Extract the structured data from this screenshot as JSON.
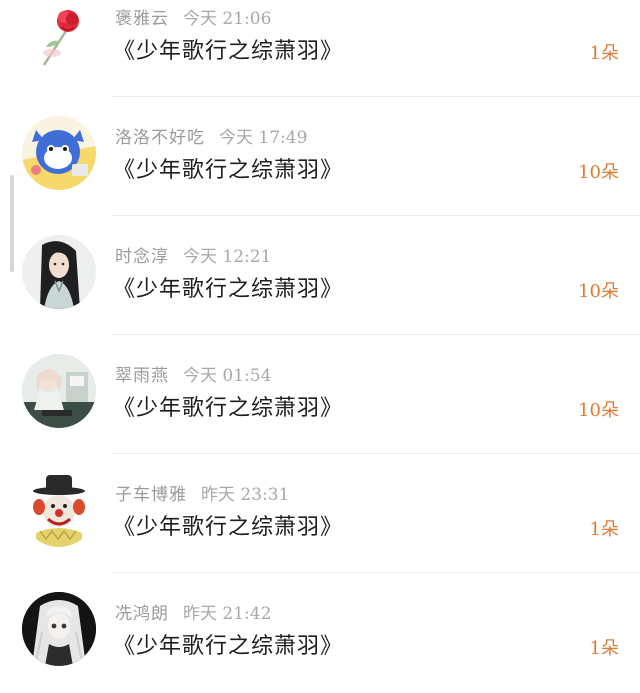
{
  "rows": [
    {
      "name": "褒雅云",
      "time": "今天 21:06",
      "gift": "《少年歌行之综萧羽》",
      "count": "1朵",
      "avatar": "rose-avatar"
    },
    {
      "name": "洛洛不好吃",
      "time": "今天 17:49",
      "gift": "《少年歌行之综萧羽》",
      "count": "10朵",
      "avatar": "cartoon-character-avatar"
    },
    {
      "name": "时念淳",
      "time": "今天 12:21",
      "gift": "《少年歌行之综萧羽》",
      "count": "10朵",
      "avatar": "long-hair-swordsman-avatar"
    },
    {
      "name": "翠雨燕",
      "time": "今天 01:54",
      "gift": "《少年歌行之综萧羽》",
      "count": "10朵",
      "avatar": "anime-girl-avatar"
    },
    {
      "name": "子车博雅",
      "time": "昨天 23:31",
      "gift": "《少年歌行之综萧羽》",
      "count": "1朵",
      "avatar": "clown-avatar"
    },
    {
      "name": "冼鸿朗",
      "time": "昨天 21:42",
      "gift": "《少年歌行之综萧羽》",
      "count": "1朵",
      "avatar": "white-hair-girl-avatar"
    }
  ],
  "colors": {
    "accent": "#e07b33",
    "meta": "#9b9b9b",
    "text": "#1e1e1e",
    "divider": "#ededed"
  }
}
